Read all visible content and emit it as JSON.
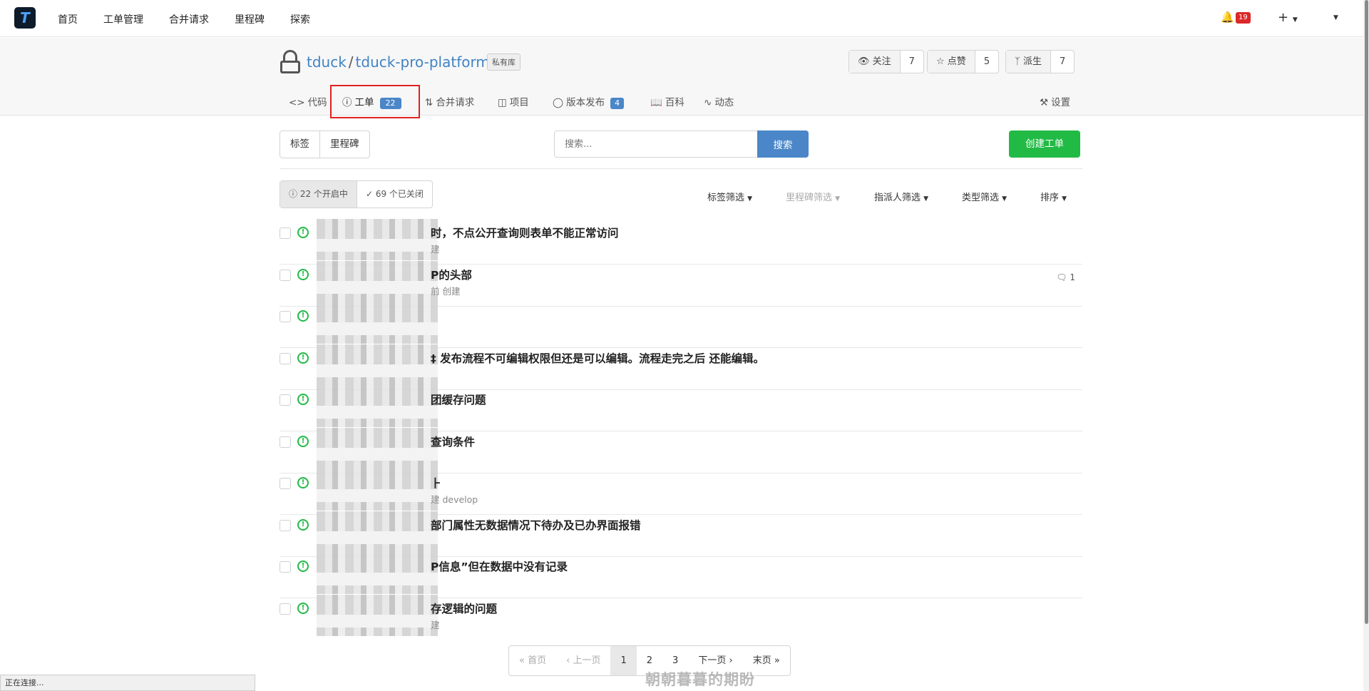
{
  "nav": {
    "logo_letter": "T",
    "items": [
      "首页",
      "工单管理",
      "合并请求",
      "里程碑",
      "探索"
    ],
    "notification_count": "19",
    "plus": "+"
  },
  "repo": {
    "owner": "tduck",
    "separator": "/",
    "name": "tduck-pro-platform",
    "private_label": "私有库",
    "watch": {
      "label": "关注",
      "count": "7"
    },
    "star": {
      "label": "点赞",
      "count": "5"
    },
    "fork": {
      "label": "派生",
      "count": "7"
    }
  },
  "tabs": {
    "code": "代码",
    "issues": "工单",
    "issues_count": "22",
    "pulls": "合并请求",
    "projects": "项目",
    "releases": "版本发布",
    "releases_count": "4",
    "wiki": "百科",
    "activity": "动态",
    "settings": "设置"
  },
  "toolbar": {
    "labels": "标签",
    "milestones": "里程碑",
    "search_placeholder": "搜索...",
    "search_button": "搜索",
    "create_button": "创建工单"
  },
  "state": {
    "open": "22 个开启中",
    "closed": "69 个已关闭"
  },
  "filters": {
    "labels": "标签筛选",
    "milestone": "里程碑筛选",
    "assignee": "指派人筛选",
    "type": "类型筛选",
    "sort": "排序"
  },
  "issues": [
    {
      "title": "时，不点公开查询则表单不能正常访问",
      "meta": "建",
      "comments": ""
    },
    {
      "title": "P的头部",
      "meta": "前 创建",
      "comments": "1"
    },
    {
      "title": "",
      "meta": "",
      "comments": ""
    },
    {
      "title": "‡ 发布流程不可编辑权限但还是可以编辑。流程走完之后 还能编辑。",
      "meta": "",
      "comments": ""
    },
    {
      "title": "团缓存问题",
      "meta": "",
      "comments": ""
    },
    {
      "title": "查询条件",
      "meta": "",
      "comments": ""
    },
    {
      "title": "⺊",
      "meta": "建  develop",
      "comments": ""
    },
    {
      "title": "部门属性无数据情况下待办及已办界面报错",
      "meta": "",
      "comments": ""
    },
    {
      "title": "P信息”但在数据中没有记录",
      "meta": "",
      "comments": ""
    },
    {
      "title": "存逻辑的问题",
      "meta": "建",
      "comments": ""
    }
  ],
  "pager": {
    "first": "首页",
    "prev": "上一页",
    "pages": [
      "1",
      "2",
      "3"
    ],
    "next": "下一页",
    "last": "末页"
  },
  "status_text": "正在连接...",
  "watermark": "朝朝暮暮的期盼"
}
